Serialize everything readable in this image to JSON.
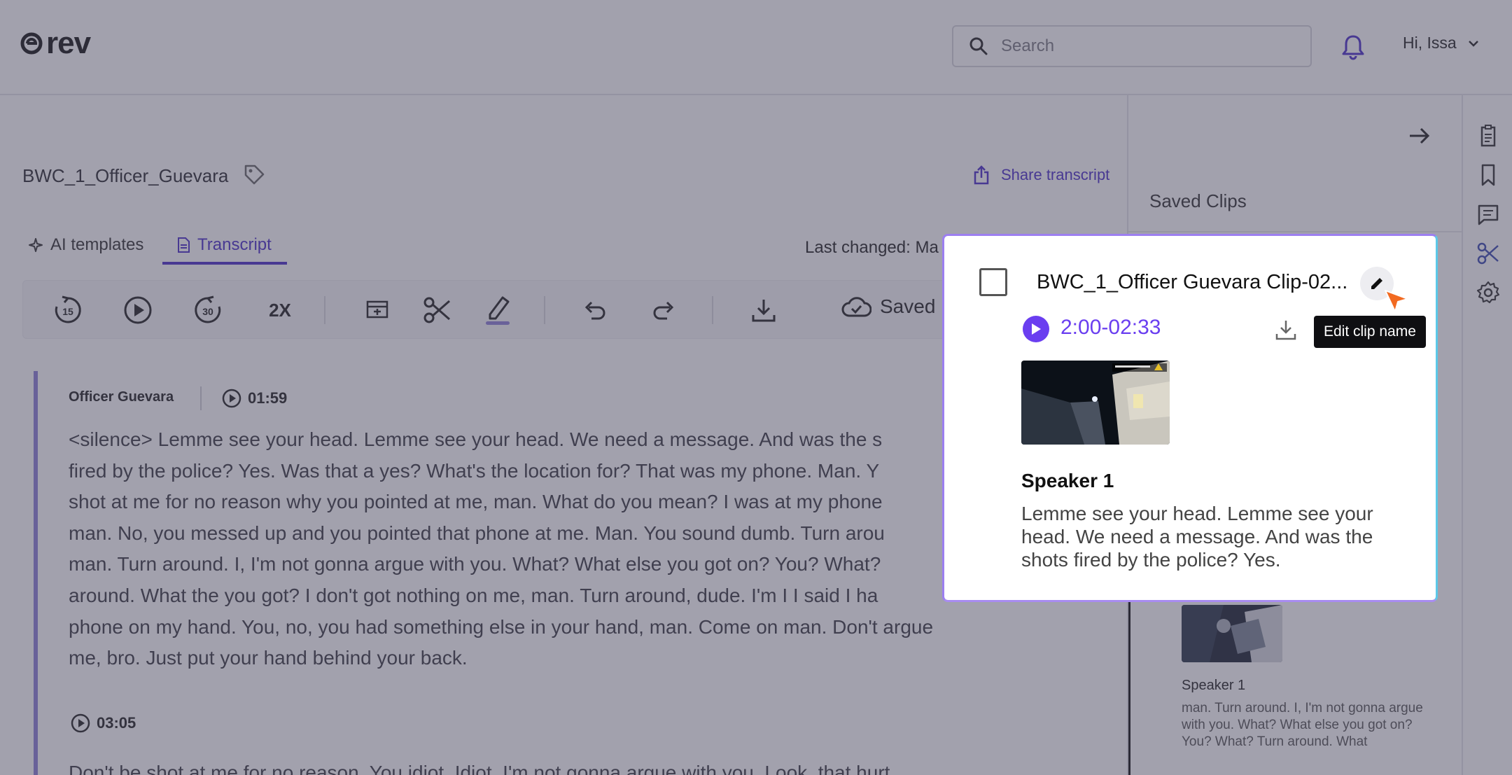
{
  "header": {
    "logo_text": "rev",
    "search_placeholder": "Search",
    "greeting": "Hi, Issa"
  },
  "document": {
    "title": "BWC_1_Officer_Guevara",
    "share_label": "Share transcript",
    "last_changed": "Last changed: Ma"
  },
  "tabs": [
    {
      "label": "AI templates",
      "icon": "sparkle-icon",
      "active": false
    },
    {
      "label": "Transcript",
      "icon": "document-icon",
      "active": true
    }
  ],
  "toolbar": {
    "rewind_label": "15",
    "forward_label": "30",
    "speed_label": "2X",
    "saved_label": "Saved",
    "highlight_color": "#8c7fd6"
  },
  "transcript": {
    "segment1": {
      "speaker": "Officer Guevara",
      "timestamp": "01:59",
      "lines": [
        "<silence> Lemme see your head. Lemme see your head. We need a message. And was the s",
        "fired by the police? Yes. Was that a yes? What's the location for? That was my phone. Man. Y",
        "shot at me for no reason why you pointed at me, man. What do you mean? I was at my phone",
        "man. No, you messed up and you pointed that phone at me. Man. You sound dumb. Turn arou",
        "man. Turn around. I, I'm not gonna argue with you. What? What else you got on? You? What?",
        "around. What the you got? I don't got nothing on me, man. Turn around, dude. I'm I I said I ha",
        "phone on my hand. You, no, you had something else in your hand, man. Come on man. Don't argue",
        "me, bro. Just put your hand behind your back."
      ]
    },
    "segment2": {
      "timestamp": "03:05",
      "text": "Don't be shot at me for no reason. You idiot. Idiot. I'm not gonna argue with you. Look, that hurt."
    }
  },
  "right_panel": {
    "title": "Saved Clips",
    "clip2": {
      "speaker": "Speaker 1",
      "text": "man. Turn around. I, I'm not gonna argue with you. What? What else you got on? You? What? Turn around. What"
    }
  },
  "popup": {
    "clip_title": "BWC_1_Officer Guevara Clip-02...",
    "time_range": "2:00-02:33",
    "tooltip": "Edit clip name",
    "speaker": "Speaker 1",
    "text": "Lemme see your head. Lemme see your head. We need a message. And was the shots fired by the police? Yes."
  },
  "colors": {
    "accent": "#4b2fc9",
    "play": "#6a3ef0",
    "cursor": "#f26a21"
  }
}
